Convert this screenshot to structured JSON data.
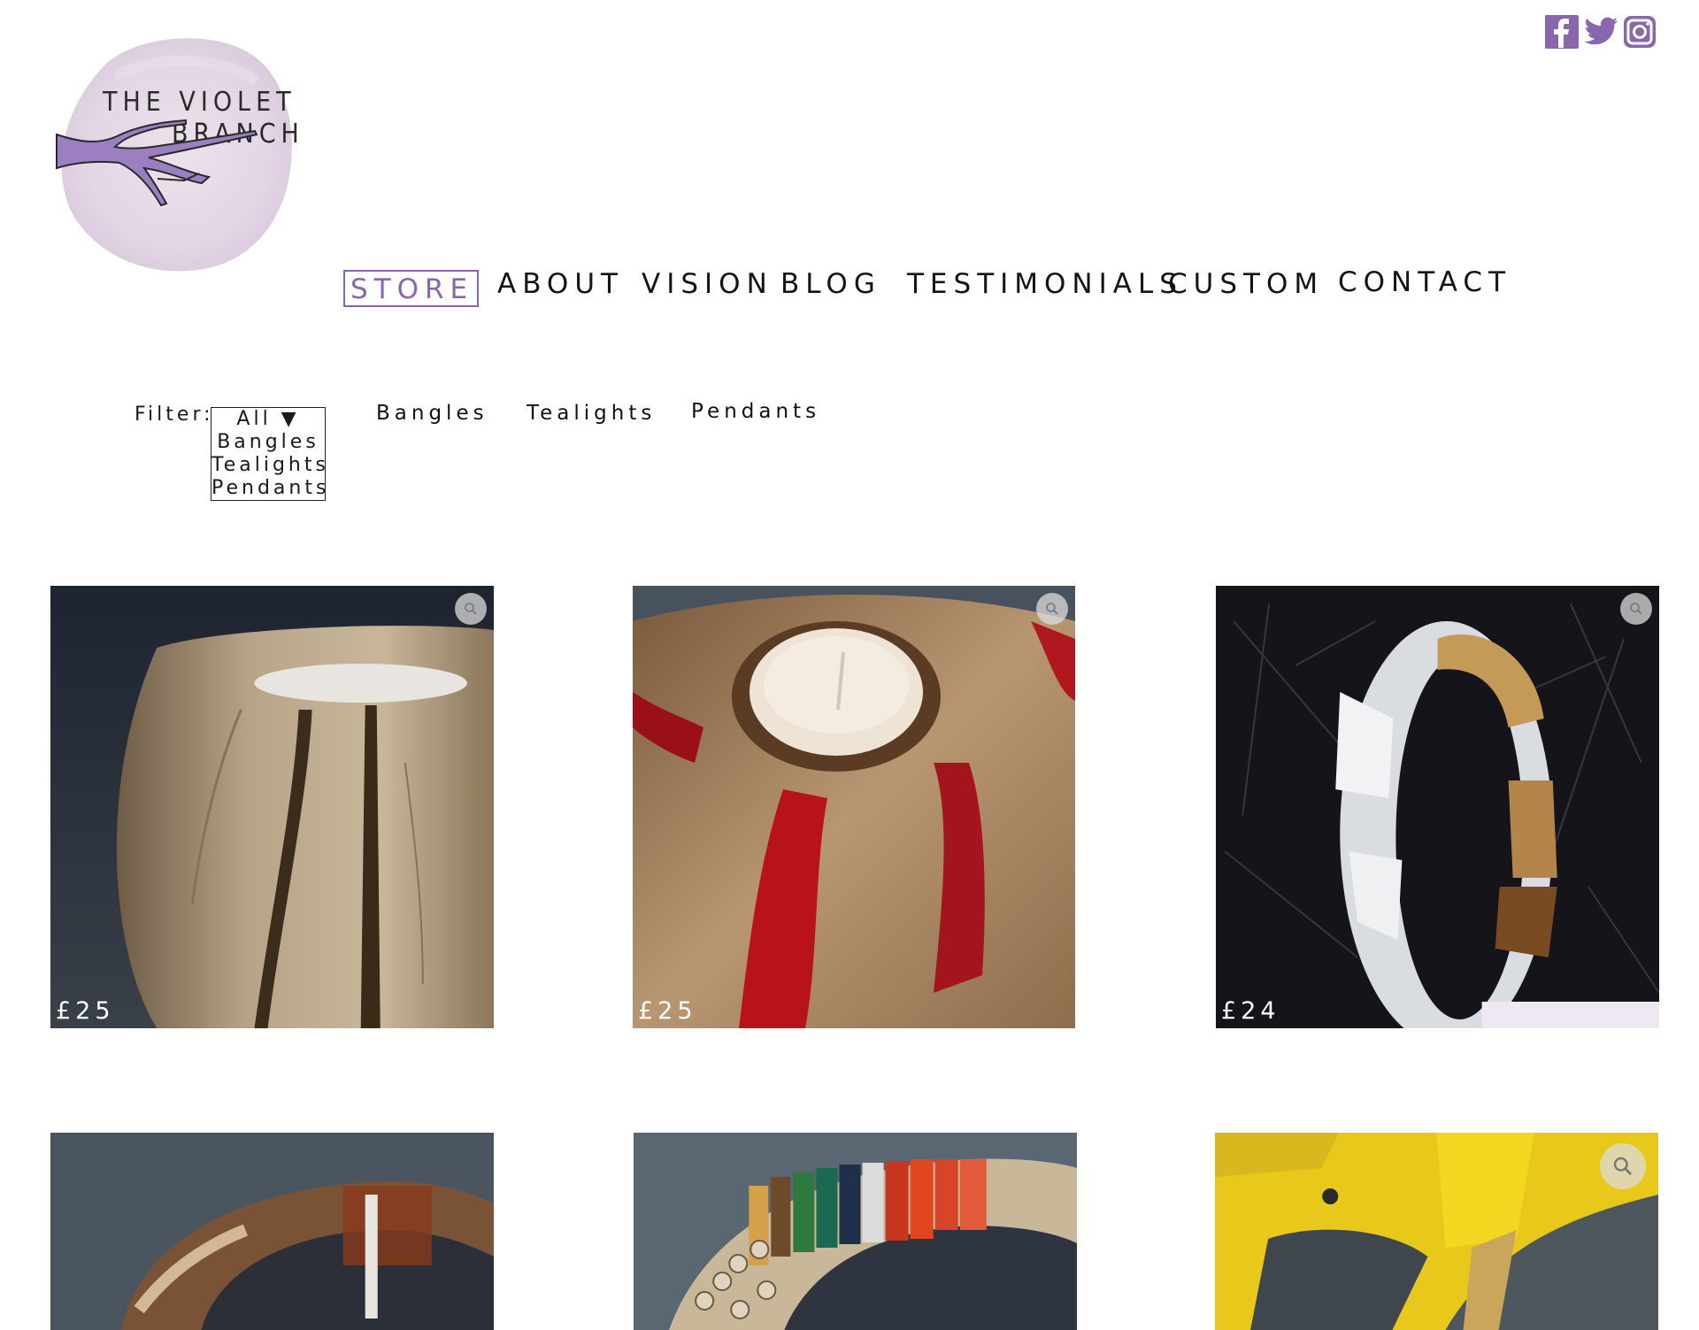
{
  "brand": {
    "logo_line1": "THE VIOLET",
    "logo_line2": "BRANCH",
    "accent_color": "#8a67ad"
  },
  "social": [
    {
      "icon": "facebook-icon"
    },
    {
      "icon": "twitter-icon"
    },
    {
      "icon": "instagram-icon"
    }
  ],
  "nav": {
    "items": [
      {
        "label": "STORE",
        "active": true
      },
      {
        "label": "ABOUT",
        "active": false
      },
      {
        "label": "VISION",
        "active": false
      },
      {
        "label": "BLOG",
        "active": false
      },
      {
        "label": "TESTIMONIALS",
        "active": false
      },
      {
        "label": "CUSTOM",
        "active": false
      },
      {
        "label": "CONTACT",
        "active": false
      }
    ]
  },
  "filter": {
    "label": "Filter:",
    "selected": "All ▼",
    "options": [
      "Bangles",
      "Tealights",
      "Pendants"
    ],
    "links": [
      "Bangles",
      "Tealights",
      "Pendants"
    ]
  },
  "products": [
    {
      "price": "£25",
      "icon": "zoom-icon"
    },
    {
      "price": "£25",
      "icon": "zoom-icon"
    },
    {
      "price": "£24",
      "icon": "zoom-icon"
    },
    {
      "price": "",
      "icon": ""
    },
    {
      "price": "",
      "icon": ""
    },
    {
      "price": "",
      "icon": "zoom-icon"
    }
  ]
}
